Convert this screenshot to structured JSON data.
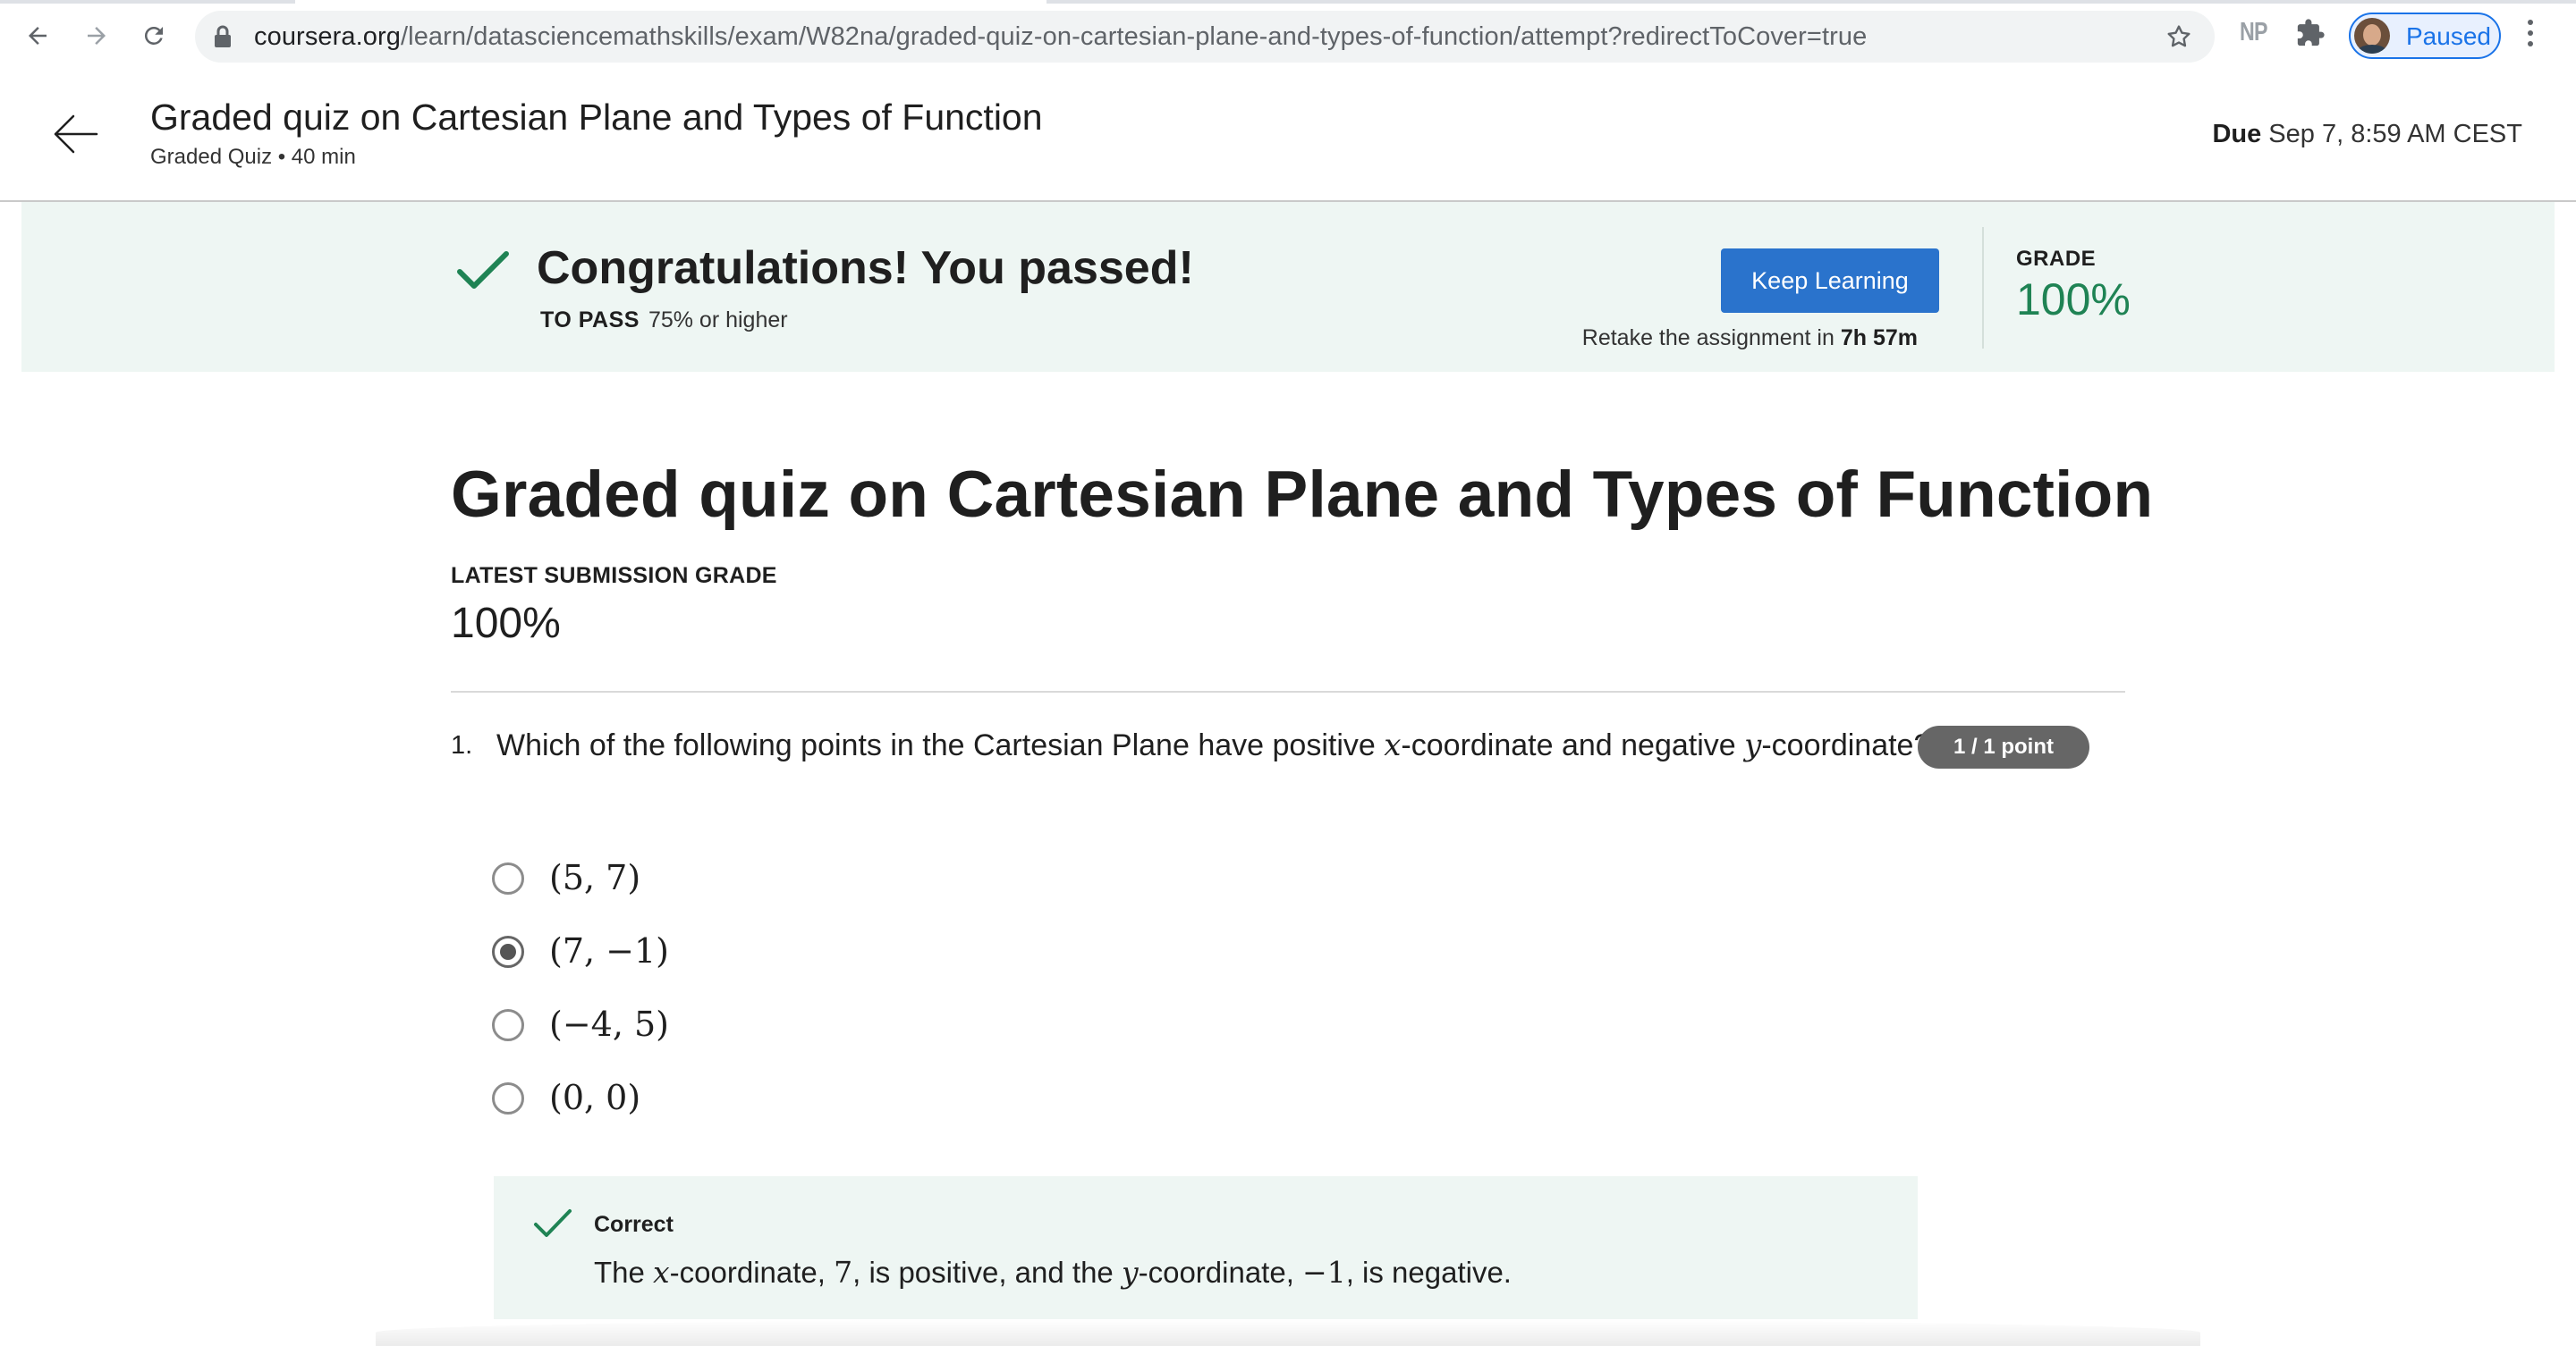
{
  "browser": {
    "url_host": "coursera.org",
    "url_path": "/learn/datasciencemathskills/exam/W82na/graded-quiz-on-cartesian-plane-and-types-of-function/attempt?redirectToCover=true",
    "extension_np": "NP",
    "profile_status": "Paused",
    "icons": [
      "back-icon",
      "forward-icon",
      "reload-icon",
      "lock-icon",
      "bookmark-star-icon",
      "extensions-puzzle-icon",
      "menu-kebab-icon"
    ]
  },
  "header": {
    "title": "Graded quiz on Cartesian Plane and Types of Function",
    "subtitle": "Graded Quiz • 40 min",
    "due_label": "Due",
    "due_value": " Sep 7, 8:59 AM CEST"
  },
  "banner": {
    "title": "Congratulations! You passed!",
    "to_pass_label": "TO PASS",
    "to_pass_value": "75% or higher",
    "keep_learning": "Keep Learning",
    "retake_prefix": "Retake the assignment in ",
    "retake_time": "7h 57m",
    "grade_label": "GRADE",
    "grade_value": "100%",
    "accent_color": "#1f8354"
  },
  "main": {
    "title": "Graded quiz on Cartesian Plane and Types of Function",
    "latest_label": "LATEST SUBMISSION GRADE",
    "latest_value": "100%"
  },
  "question": {
    "number": "1.",
    "text_before_x": "Which of the following points in the Cartesian Plane have positive ",
    "var_x": "x",
    "text_middle": "-coordinate and negative ",
    "var_y": "y",
    "text_after": "-coordinate?",
    "points": "1 / 1 point",
    "options": [
      {
        "label": "(5, 7)",
        "selected": false
      },
      {
        "label": "(7, −1)",
        "selected": true
      },
      {
        "label": "(−4, 5)",
        "selected": false
      },
      {
        "label": "(0, 0)",
        "selected": false
      }
    ],
    "feedback": {
      "title": "Correct",
      "part1": "The ",
      "var_x": "x",
      "part2": "-coordinate, ",
      "val_x": "7",
      "part3": ", is positive, and the ",
      "var_y": "y",
      "part4": "-coordinate, ",
      "val_y": "−1",
      "part5": ", is negative."
    }
  }
}
